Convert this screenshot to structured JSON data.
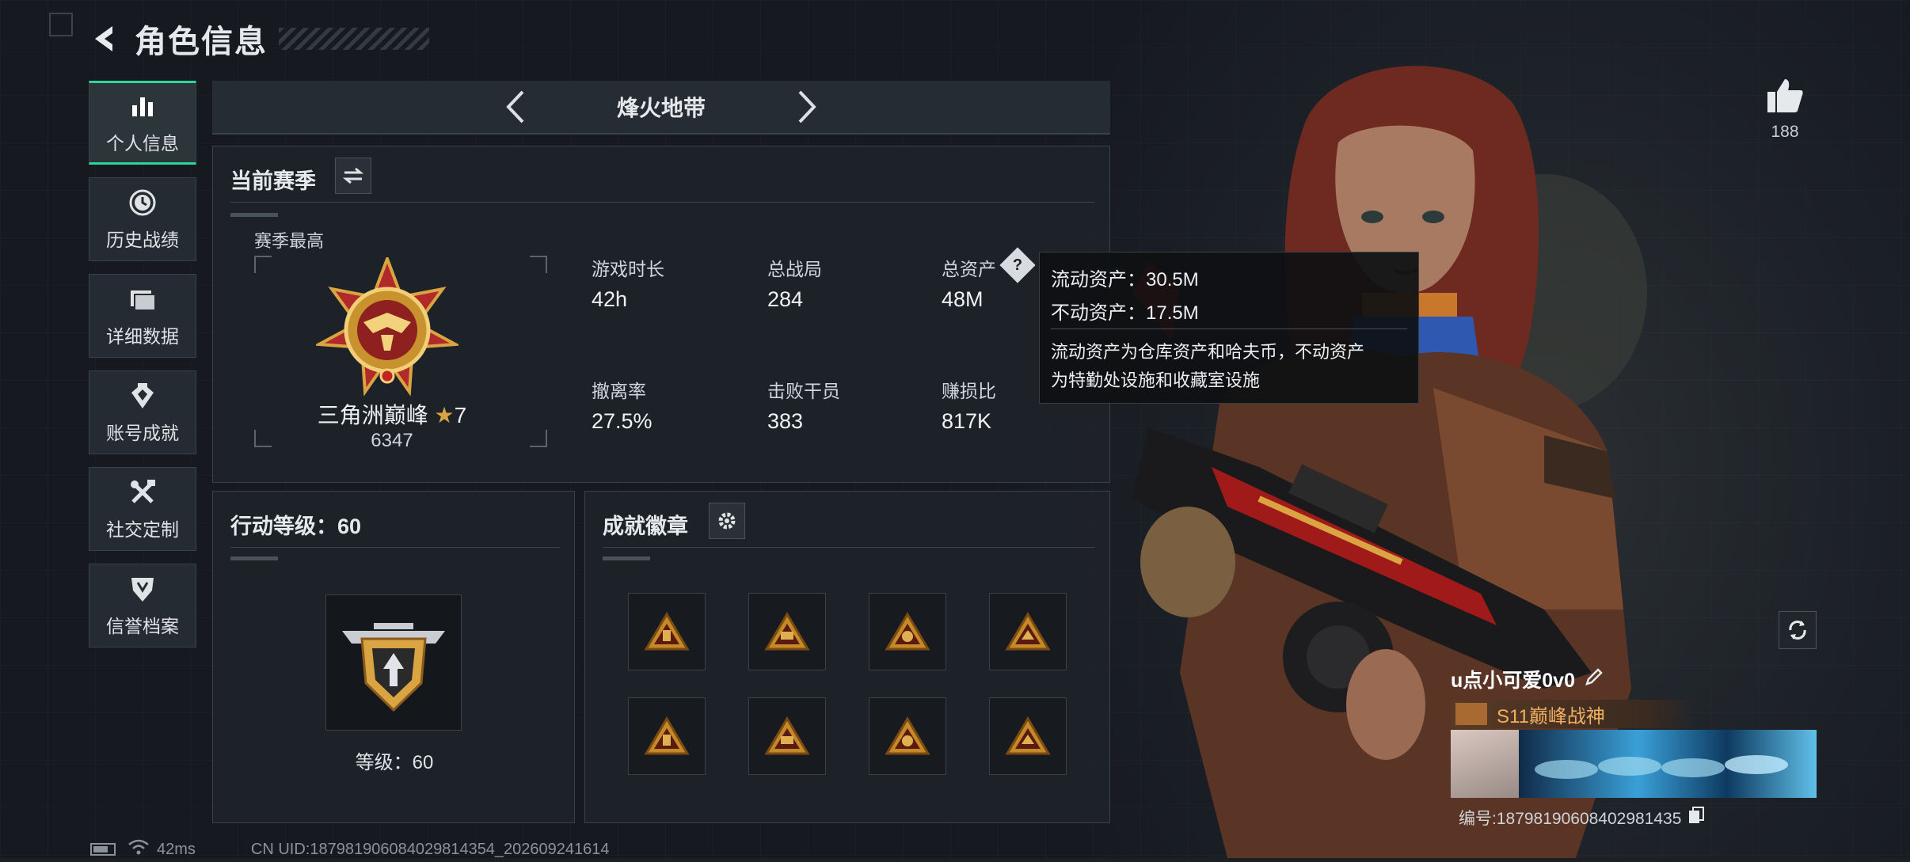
{
  "header": {
    "title": "角色信息"
  },
  "nav": {
    "items": [
      {
        "label": "个人信息",
        "icon": "bar-chart-icon",
        "active": true
      },
      {
        "label": "历史战绩",
        "icon": "clock-icon"
      },
      {
        "label": "详细数据",
        "icon": "folder-icon"
      },
      {
        "label": "账号成就",
        "icon": "achievement-icon"
      },
      {
        "label": "社交定制",
        "icon": "tools-icon"
      },
      {
        "label": "信誉档案",
        "icon": "shield-icon"
      }
    ]
  },
  "mode_tab": {
    "label": "烽火地带"
  },
  "season": {
    "title": "当前赛季",
    "best_label": "赛季最高",
    "rank_name": "三角洲巅峰",
    "rank_stars": "7",
    "rank_score": "6347",
    "stats": [
      {
        "label": "游戏时长",
        "value": "42h"
      },
      {
        "label": "总战局",
        "value": "284"
      },
      {
        "label": "总资产",
        "value": "48M"
      },
      {
        "label": "撤离率",
        "value": "27.5%"
      },
      {
        "label": "击败干员",
        "value": "383"
      },
      {
        "label": "赚损比",
        "value": "817K"
      }
    ]
  },
  "tooltip": {
    "liquid": "流动资产：30.5M",
    "fixed": "不动资产：17.5M",
    "desc1": "流动资产为仓库资产和哈夫币，不动资产",
    "desc2": "为特勤处设施和收藏室设施"
  },
  "action_level": {
    "title": "行动等级：60",
    "level_text": "等级：60"
  },
  "badges": {
    "title": "成就徽章",
    "count": 8
  },
  "likes": {
    "count": "188"
  },
  "player": {
    "name": "u点小可爱0v0",
    "title": "S11巅峰战神",
    "id_line": "编号:18798190608402981435"
  },
  "status_bar": {
    "ping": "42ms",
    "uid": "CN UID:187981906084029814354_202609241614"
  },
  "colors": {
    "accent": "#2fd49a",
    "gold": "#d9a441",
    "title_orange": "#f0b060"
  }
}
